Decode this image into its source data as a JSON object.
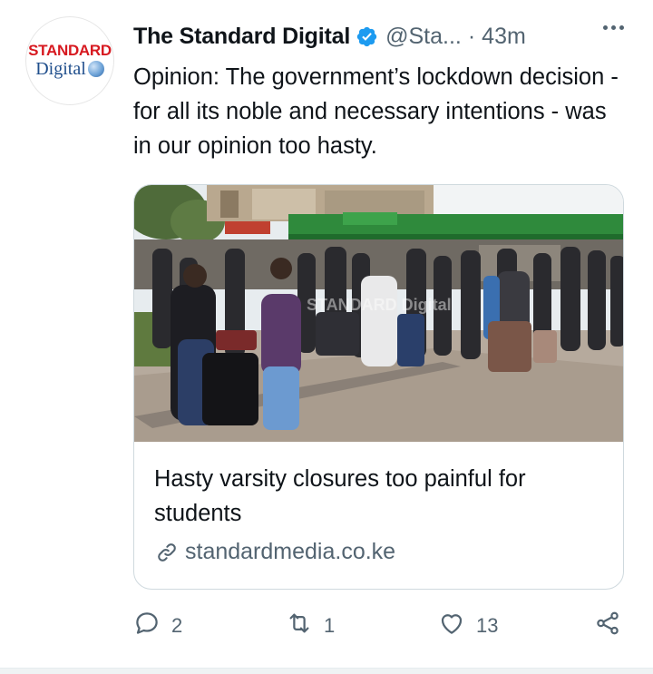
{
  "account": {
    "avatar_top": "STANDARD",
    "avatar_bottom": "Digital",
    "display_name": "The Standard Digital",
    "handle": "@Sta...",
    "separator": "·",
    "time": "43m",
    "verified": true
  },
  "tweet": {
    "text": "Opinion: The government’s lockdown decision - for all its noble and necessary intentions - was in our opinion too hasty."
  },
  "card": {
    "image_watermark": "STANDARD Digital",
    "title": "Hasty varsity closures too painful for students",
    "domain": "standardmedia.co.ke"
  },
  "actions": {
    "reply_count": "2",
    "retweet_count": "1",
    "like_count": "13"
  },
  "colors": {
    "text": "#0f1419",
    "secondary": "#536471",
    "verified": "#1d9bf0",
    "border": "#cfd9de",
    "brand_red": "#d71920",
    "brand_blue": "#1f4e8c"
  },
  "icons": [
    "verified-badge-icon",
    "more-icon",
    "link-icon",
    "reply-icon",
    "retweet-icon",
    "like-icon",
    "share-icon"
  ]
}
